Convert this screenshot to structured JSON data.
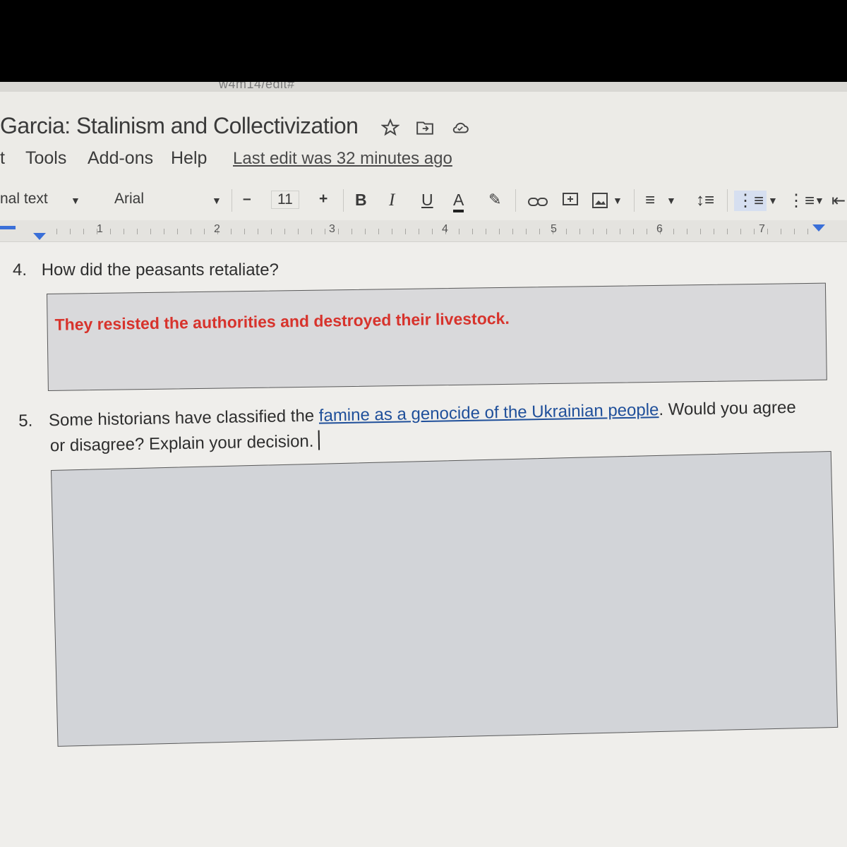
{
  "browser": {
    "url_fragment": "w4m14/edit#"
  },
  "document": {
    "title": "Garcia: Stalinism and Collectivization"
  },
  "menu": {
    "items": [
      "t",
      "Tools",
      "Add-ons",
      "Help"
    ],
    "last_edit": "Last edit was 32 minutes ago"
  },
  "toolbar": {
    "style": "nal text",
    "font": "Arial",
    "minus": "–",
    "font_size": "11",
    "plus": "+",
    "bold": "B",
    "italic": "I",
    "underline": "U",
    "text_color": "A"
  },
  "ruler": {
    "numbers": [
      "1",
      "2",
      "3",
      "4",
      "5",
      "6",
      "7"
    ]
  },
  "questions": {
    "q4": {
      "number": "4.",
      "text": "How did the peasants retaliate?"
    },
    "q4_answer": "They resisted the authorities and destroyed their livestock.",
    "q5": {
      "number": "5.",
      "text_before": "Some historians have classified the ",
      "link": "famine as a genocide of the Ukrainian people",
      "text_after": ". Would you agree",
      "line2": "or disagree? Explain your decision."
    }
  },
  "colors": {
    "answer_text": "#d7332c",
    "link": "#1f4f9a",
    "ruler_marker": "#3a6fd8"
  }
}
